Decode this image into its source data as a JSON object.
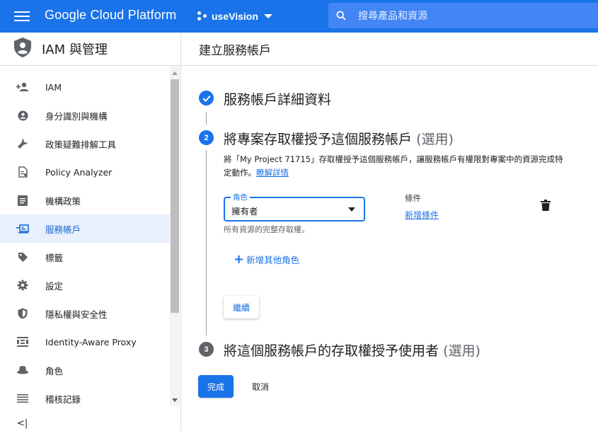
{
  "topbar": {
    "brand": "Google Cloud Platform",
    "project_name": "useVision",
    "search_placeholder": "搜尋產品和資源"
  },
  "sidebar": {
    "title": "IAM 與管理",
    "items": [
      {
        "label": "IAM",
        "icon": "person-add-icon"
      },
      {
        "label": "身分識別與機構",
        "icon": "account-circle-icon"
      },
      {
        "label": "政策疑難排解工具",
        "icon": "wrench-icon"
      },
      {
        "label": "Policy Analyzer",
        "icon": "policy-document-icon"
      },
      {
        "label": "機構政策",
        "icon": "list-document-icon"
      },
      {
        "label": "服務帳戶",
        "icon": "service-account-icon",
        "active": true
      },
      {
        "label": "標籤",
        "icon": "label-tag-icon"
      },
      {
        "label": "設定",
        "icon": "gear-icon"
      },
      {
        "label": "隱私權與安全性",
        "icon": "shield-icon"
      },
      {
        "label": "Identity-Aware Proxy",
        "icon": "proxy-grid-icon"
      },
      {
        "label": "角色",
        "icon": "hat-icon"
      },
      {
        "label": "稽核記錄",
        "icon": "lines-icon"
      }
    ],
    "collapse_label": "<|"
  },
  "main": {
    "page_title": "建立服務帳戶",
    "step1": {
      "title": "服務帳戶詳細資料"
    },
    "step2": {
      "number": "2",
      "title": "將專案存取權授予這個服務帳戶",
      "optional": "(選用)",
      "description": "將「My Project 71715」存取權授予這個服務帳戶，讓服務帳戶有權限對專案中的資源完成特定動作。",
      "learn_more": "瞭解詳情",
      "role_label": "角色",
      "role_value": "擁有者",
      "role_hint": "所有資源的完整存取權。",
      "condition_label": "條件",
      "add_condition": "新增條件",
      "add_role": "新增其他角色",
      "continue": "繼續"
    },
    "step3": {
      "number": "3",
      "title": "將這個服務帳戶的存取權授予使用者",
      "optional": "(選用)"
    },
    "done": "完成",
    "cancel": "取消"
  },
  "colors": {
    "accent": "#1a73e8",
    "active_bg": "#e8f0fe",
    "step3_badge": "#5f6368"
  }
}
